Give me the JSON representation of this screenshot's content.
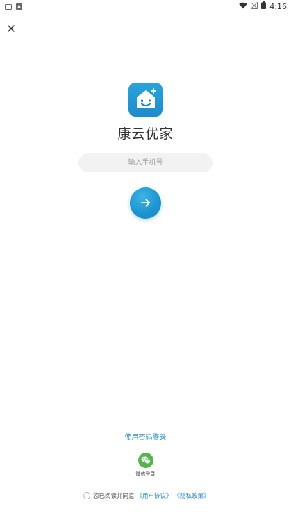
{
  "status_bar": {
    "time": "4:16"
  },
  "app": {
    "name": "康云优家"
  },
  "phone": {
    "placeholder": "输入手机号",
    "value": ""
  },
  "password_login": {
    "label": "使用密码登录"
  },
  "wechat": {
    "label": "微信登录"
  },
  "agreement": {
    "text": "您已阅读并同意",
    "user_agreement": "《用户协议》",
    "privacy_policy": "《隐私政策》"
  },
  "colors": {
    "accent": "#1c8ccc",
    "link": "#2a8bd0",
    "wechat_green": "#54b54c",
    "input_bg": "#f2f2f2"
  }
}
